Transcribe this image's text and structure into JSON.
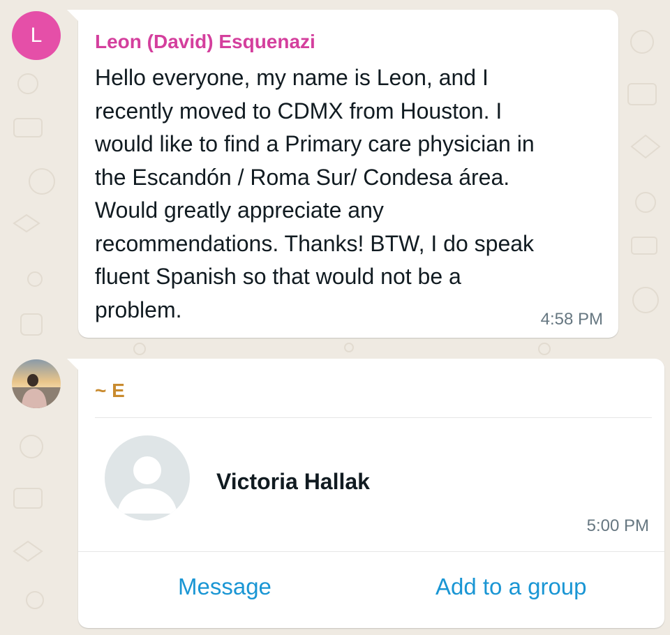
{
  "messages": [
    {
      "avatar_letter": "L",
      "sender": "Leon (David) Esquenazi",
      "text": "Hello everyone, my name is Leon, and I\nrecently moved to CDMX from Houston. I\nwould like to find a Primary care physician in\nthe Escandón / Roma Sur/ Condesa área.\nWould greatly appreciate any\nrecommendations. Thanks! BTW, I do speak\nfluent Spanish so that would not be a\nproblem.",
      "time": "4:58 PM"
    },
    {
      "sender": "~ E",
      "contact_card": {
        "name": "Victoria Hallak",
        "time": "5:00 PM",
        "actions": {
          "message": "Message",
          "add_to_group": "Add to a group"
        }
      }
    }
  ],
  "colors": {
    "background": "#efeae2",
    "bubble": "#ffffff",
    "avatar_L": "#e54fa8",
    "sender_1": "#d43f9d",
    "sender_2": "#c98b2f",
    "link_blue": "#1a96d4",
    "timestamp": "#667781"
  },
  "icons": {
    "contact_placeholder": "person-silhouette-icon"
  }
}
